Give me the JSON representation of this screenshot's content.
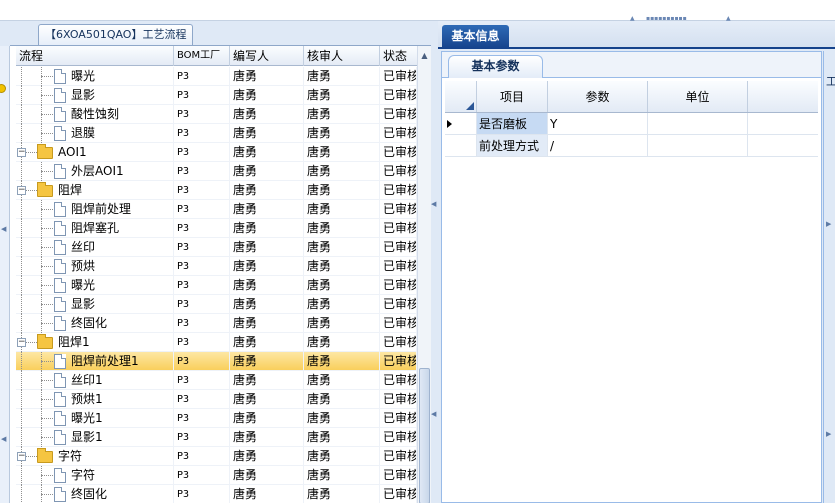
{
  "colors": {
    "accent": "#15428b",
    "selection": "#f9cf5c",
    "panel_bg": "#dfe9f6"
  },
  "left_panel": {
    "tab_title": "【6XOA501QAO】工艺流程",
    "columns": [
      "流程",
      "BOM工厂",
      "编写人",
      "核审人",
      "状态"
    ],
    "rows": [
      {
        "label": "曝光",
        "level": 2,
        "type": "doc",
        "bom": "P3",
        "author": "唐勇",
        "checker": "唐勇",
        "status": "已审核"
      },
      {
        "label": "显影",
        "level": 2,
        "type": "doc",
        "bom": "P3",
        "author": "唐勇",
        "checker": "唐勇",
        "status": "已审核"
      },
      {
        "label": "酸性蚀刻",
        "level": 2,
        "type": "doc",
        "bom": "P3",
        "author": "唐勇",
        "checker": "唐勇",
        "status": "已审核"
      },
      {
        "label": "退膜",
        "level": 2,
        "type": "doc",
        "bom": "P3",
        "author": "唐勇",
        "checker": "唐勇",
        "status": "已审核"
      },
      {
        "label": "AOI1",
        "level": 1,
        "type": "folder",
        "bom": "P3",
        "author": "唐勇",
        "checker": "唐勇",
        "status": "已审核"
      },
      {
        "label": "外层AOI1",
        "level": 2,
        "type": "doc",
        "bom": "P3",
        "author": "唐勇",
        "checker": "唐勇",
        "status": "已审核"
      },
      {
        "label": "阻焊",
        "level": 1,
        "type": "folder",
        "bom": "P3",
        "author": "唐勇",
        "checker": "唐勇",
        "status": "已审核"
      },
      {
        "label": "阻焊前处理",
        "level": 2,
        "type": "doc",
        "bom": "P3",
        "author": "唐勇",
        "checker": "唐勇",
        "status": "已审核"
      },
      {
        "label": "阻焊塞孔",
        "level": 2,
        "type": "doc",
        "bom": "P3",
        "author": "唐勇",
        "checker": "唐勇",
        "status": "已审核"
      },
      {
        "label": "丝印",
        "level": 2,
        "type": "doc",
        "bom": "P3",
        "author": "唐勇",
        "checker": "唐勇",
        "status": "已审核"
      },
      {
        "label": "预烘",
        "level": 2,
        "type": "doc",
        "bom": "P3",
        "author": "唐勇",
        "checker": "唐勇",
        "status": "已审核"
      },
      {
        "label": "曝光",
        "level": 2,
        "type": "doc",
        "bom": "P3",
        "author": "唐勇",
        "checker": "唐勇",
        "status": "已审核"
      },
      {
        "label": "显影",
        "level": 2,
        "type": "doc",
        "bom": "P3",
        "author": "唐勇",
        "checker": "唐勇",
        "status": "已审核"
      },
      {
        "label": "终固化",
        "level": 2,
        "type": "doc",
        "bom": "P3",
        "author": "唐勇",
        "checker": "唐勇",
        "status": "已审核"
      },
      {
        "label": "阻焊1",
        "level": 1,
        "type": "folder",
        "bom": "P3",
        "author": "唐勇",
        "checker": "唐勇",
        "status": "已审核"
      },
      {
        "label": "阻焊前处理1",
        "level": 2,
        "type": "doc",
        "bom": "P3",
        "author": "唐勇",
        "checker": "唐勇",
        "status": "已审核",
        "selected": true
      },
      {
        "label": "丝印1",
        "level": 2,
        "type": "doc",
        "bom": "P3",
        "author": "唐勇",
        "checker": "唐勇",
        "status": "已审核"
      },
      {
        "label": "预烘1",
        "level": 2,
        "type": "doc",
        "bom": "P3",
        "author": "唐勇",
        "checker": "唐勇",
        "status": "已审核"
      },
      {
        "label": "曝光1",
        "level": 2,
        "type": "doc",
        "bom": "P3",
        "author": "唐勇",
        "checker": "唐勇",
        "status": "已审核"
      },
      {
        "label": "显影1",
        "level": 2,
        "type": "doc",
        "bom": "P3",
        "author": "唐勇",
        "checker": "唐勇",
        "status": "已审核"
      },
      {
        "label": "字符",
        "level": 1,
        "type": "folder",
        "bom": "P3",
        "author": "唐勇",
        "checker": "唐勇",
        "status": "已审核"
      },
      {
        "label": "字符",
        "level": 2,
        "type": "doc",
        "bom": "P3",
        "author": "唐勇",
        "checker": "唐勇",
        "status": "已审核"
      },
      {
        "label": "终固化",
        "level": 2,
        "type": "doc",
        "bom": "P3",
        "author": "唐勇",
        "checker": "唐勇",
        "status": "已审核"
      }
    ],
    "expand_glyph": "−",
    "scroll_up_glyph": "▲"
  },
  "right_panel": {
    "tab_title": "基本信息",
    "sub_tab_title": "基本参数",
    "edge_fragment": "工",
    "grid": {
      "columns": [
        "项目",
        "参数",
        "单位"
      ],
      "rows": [
        {
          "item": "是否磨板",
          "param": "Y",
          "unit": "",
          "current": true
        },
        {
          "item": "前处理方式",
          "param": "/",
          "unit": "",
          "current": false
        }
      ]
    }
  }
}
